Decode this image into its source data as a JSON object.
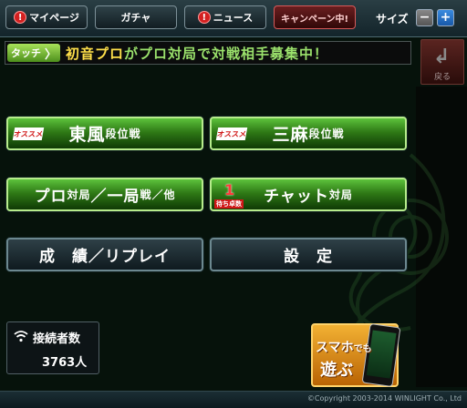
{
  "header": {
    "mypage_badge": "!",
    "mypage_label": "マイページ",
    "gacha_label": "ガチャ",
    "news_badge": "!",
    "news_label": "ニュース",
    "campaign_label": "キャンペーン中!",
    "size_label": "サイズ",
    "size_minus": "−",
    "size_plus": "+"
  },
  "ticker": {
    "touch_label": "タッチ",
    "touch_chevron": "〉",
    "highlight": "初音プロ",
    "message": "がプロ対局で対戦相手募集中！"
  },
  "back_button": {
    "arrow": "↲",
    "label": "戻る"
  },
  "menu": {
    "osusume": "オススメ",
    "tonpu_main": "東風",
    "tonpu_sub": "段位戦",
    "sanma_main": "三麻",
    "sanma_sub": "段位戦",
    "pro_a": "プロ",
    "pro_b": "対局",
    "pro_c": "／一局",
    "pro_d": "戦",
    "pro_e": "／他",
    "chat_count": "1",
    "chat_wait_label": "待ち卓数",
    "chat_main": "チャット",
    "chat_sub": "対局",
    "results_label": "成　績／リプレイ",
    "settings_label": "設　定"
  },
  "connection": {
    "title": "接続者数",
    "count": "3763人"
  },
  "promo": {
    "line1_a": "スマホ",
    "line1_b": "でも",
    "line2": "遊ぶ"
  },
  "footer": {
    "copyright": "©Copyright 2003-2014 WINLIGHT Co., Ltd"
  }
}
